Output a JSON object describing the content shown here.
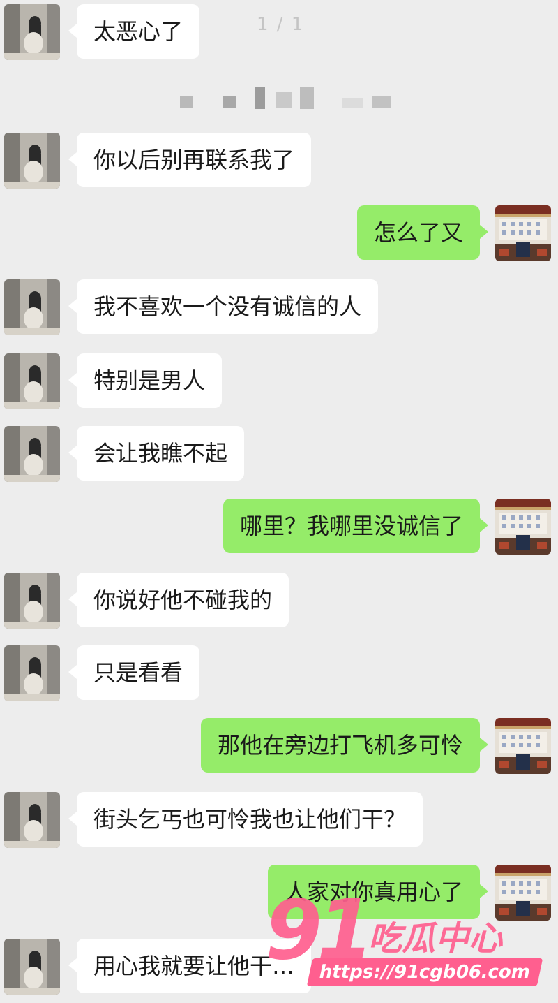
{
  "page_indicator": "1 / 1",
  "messages": [
    {
      "side": "left",
      "text": "太恶心了"
    },
    {
      "side": "left",
      "text": "你以后别再联系我了"
    },
    {
      "side": "right",
      "text": "怎么了又"
    },
    {
      "side": "left",
      "text": "我不喜欢一个没有诚信的人"
    },
    {
      "side": "left",
      "text": "特别是男人"
    },
    {
      "side": "left",
      "text": "会让我瞧不起"
    },
    {
      "side": "right",
      "text": "哪里？我哪里没诚信了"
    },
    {
      "side": "left",
      "text": "你说好他不碰我的"
    },
    {
      "side": "left",
      "text": "只是看看"
    },
    {
      "side": "right",
      "text": "那他在旁边打飞机多可怜"
    },
    {
      "side": "left",
      "text": "街头乞丐也可怜我也让他们干？"
    },
    {
      "side": "right",
      "text": "人家对你真用心了"
    },
    {
      "side": "left",
      "text": "用心我就要让他干…"
    }
  ],
  "watermark": {
    "number": "91",
    "brand": "吃瓜中心",
    "url": "https://91cgb06.com"
  },
  "colors": {
    "background": "#ededed",
    "incoming_bubble": "#ffffff",
    "outgoing_bubble": "#95ec69",
    "watermark": "#ff5f8f"
  }
}
